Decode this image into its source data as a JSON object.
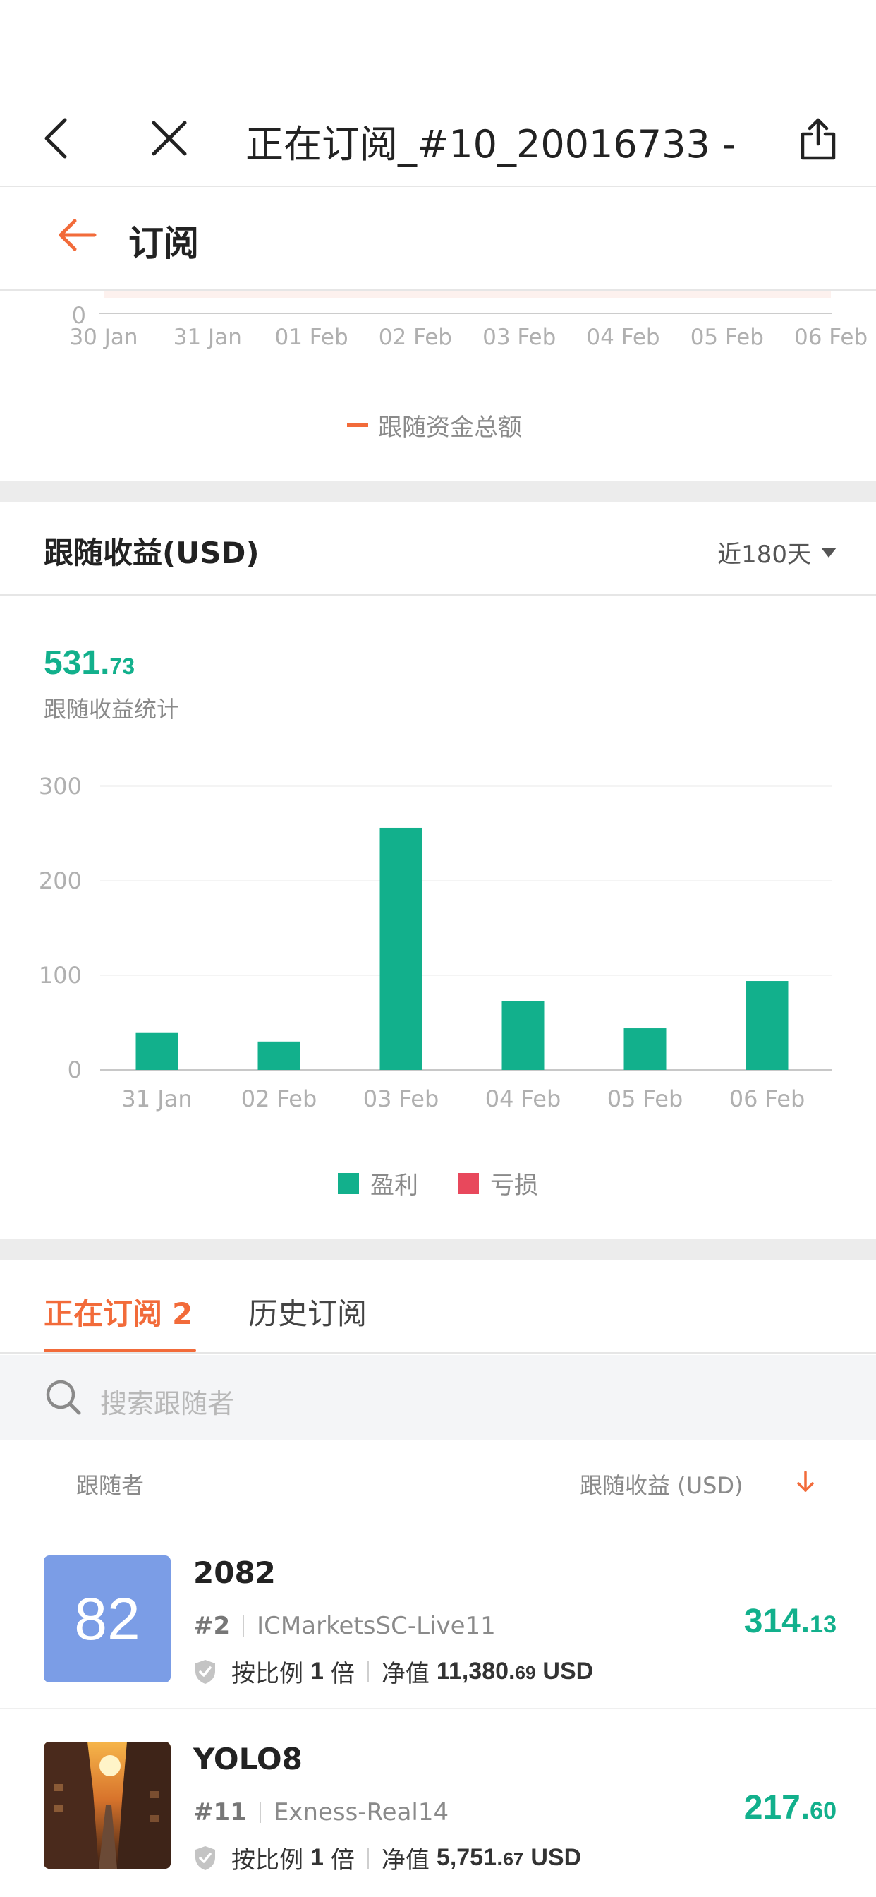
{
  "nav": {
    "title": "正在订阅_#10_20016733 -..."
  },
  "page": {
    "title": "订阅"
  },
  "top_chart": {
    "y_tick": "0",
    "x_ticks": [
      "30 Jan",
      "31 Jan",
      "01 Feb",
      "02 Feb",
      "03 Feb",
      "04 Feb",
      "05 Feb",
      "06 Feb"
    ],
    "legend": "跟随资金总额",
    "series_color": "#f26b3a"
  },
  "profit_section": {
    "title": "跟随收益(USD)",
    "period": "近180天",
    "total_int": "531.",
    "total_dec": "73",
    "total_label": "跟随收益统计"
  },
  "chart_data": {
    "type": "bar",
    "categories": [
      "31 Jan",
      "02 Feb",
      "03 Feb",
      "04 Feb",
      "05 Feb",
      "06 Feb"
    ],
    "series": [
      {
        "name": "盈利",
        "color": "#12b08c",
        "values": [
          39,
          30,
          256,
          73,
          44,
          94
        ]
      },
      {
        "name": "亏损",
        "color": "#e8485c",
        "values": [
          0,
          0,
          0,
          0,
          0,
          0
        ]
      }
    ],
    "y_ticks": [
      "0",
      "100",
      "200",
      "300"
    ],
    "ylim": [
      0,
      300
    ],
    "grid": true,
    "legend_position": "bottom"
  },
  "tabs": {
    "active_label": "正在订阅",
    "active_count": "2",
    "other_label": "历史订阅"
  },
  "search": {
    "placeholder": "搜索跟随者"
  },
  "columns": {
    "left": "跟随者",
    "right": "跟随收益 (USD)"
  },
  "rows": [
    {
      "avatar_text": "82",
      "name": "2082",
      "rank": "#2",
      "server": "ICMarketsSC-Live11",
      "ratio_label": "按比例",
      "ratio_value": "1",
      "ratio_unit": "倍",
      "equity_label": "净值",
      "equity_int": "11,380.",
      "equity_dec": "69",
      "equity_currency": "USD",
      "profit_int": "314.",
      "profit_dec": "13"
    },
    {
      "avatar_text": "",
      "name": "YOLO8",
      "rank": "#11",
      "server": "Exness-Real14",
      "ratio_label": "按比例",
      "ratio_value": "1",
      "ratio_unit": "倍",
      "equity_label": "净值",
      "equity_int": "5,751.",
      "equity_dec": "67",
      "equity_currency": "USD",
      "profit_int": "217.",
      "profit_dec": "60"
    }
  ]
}
